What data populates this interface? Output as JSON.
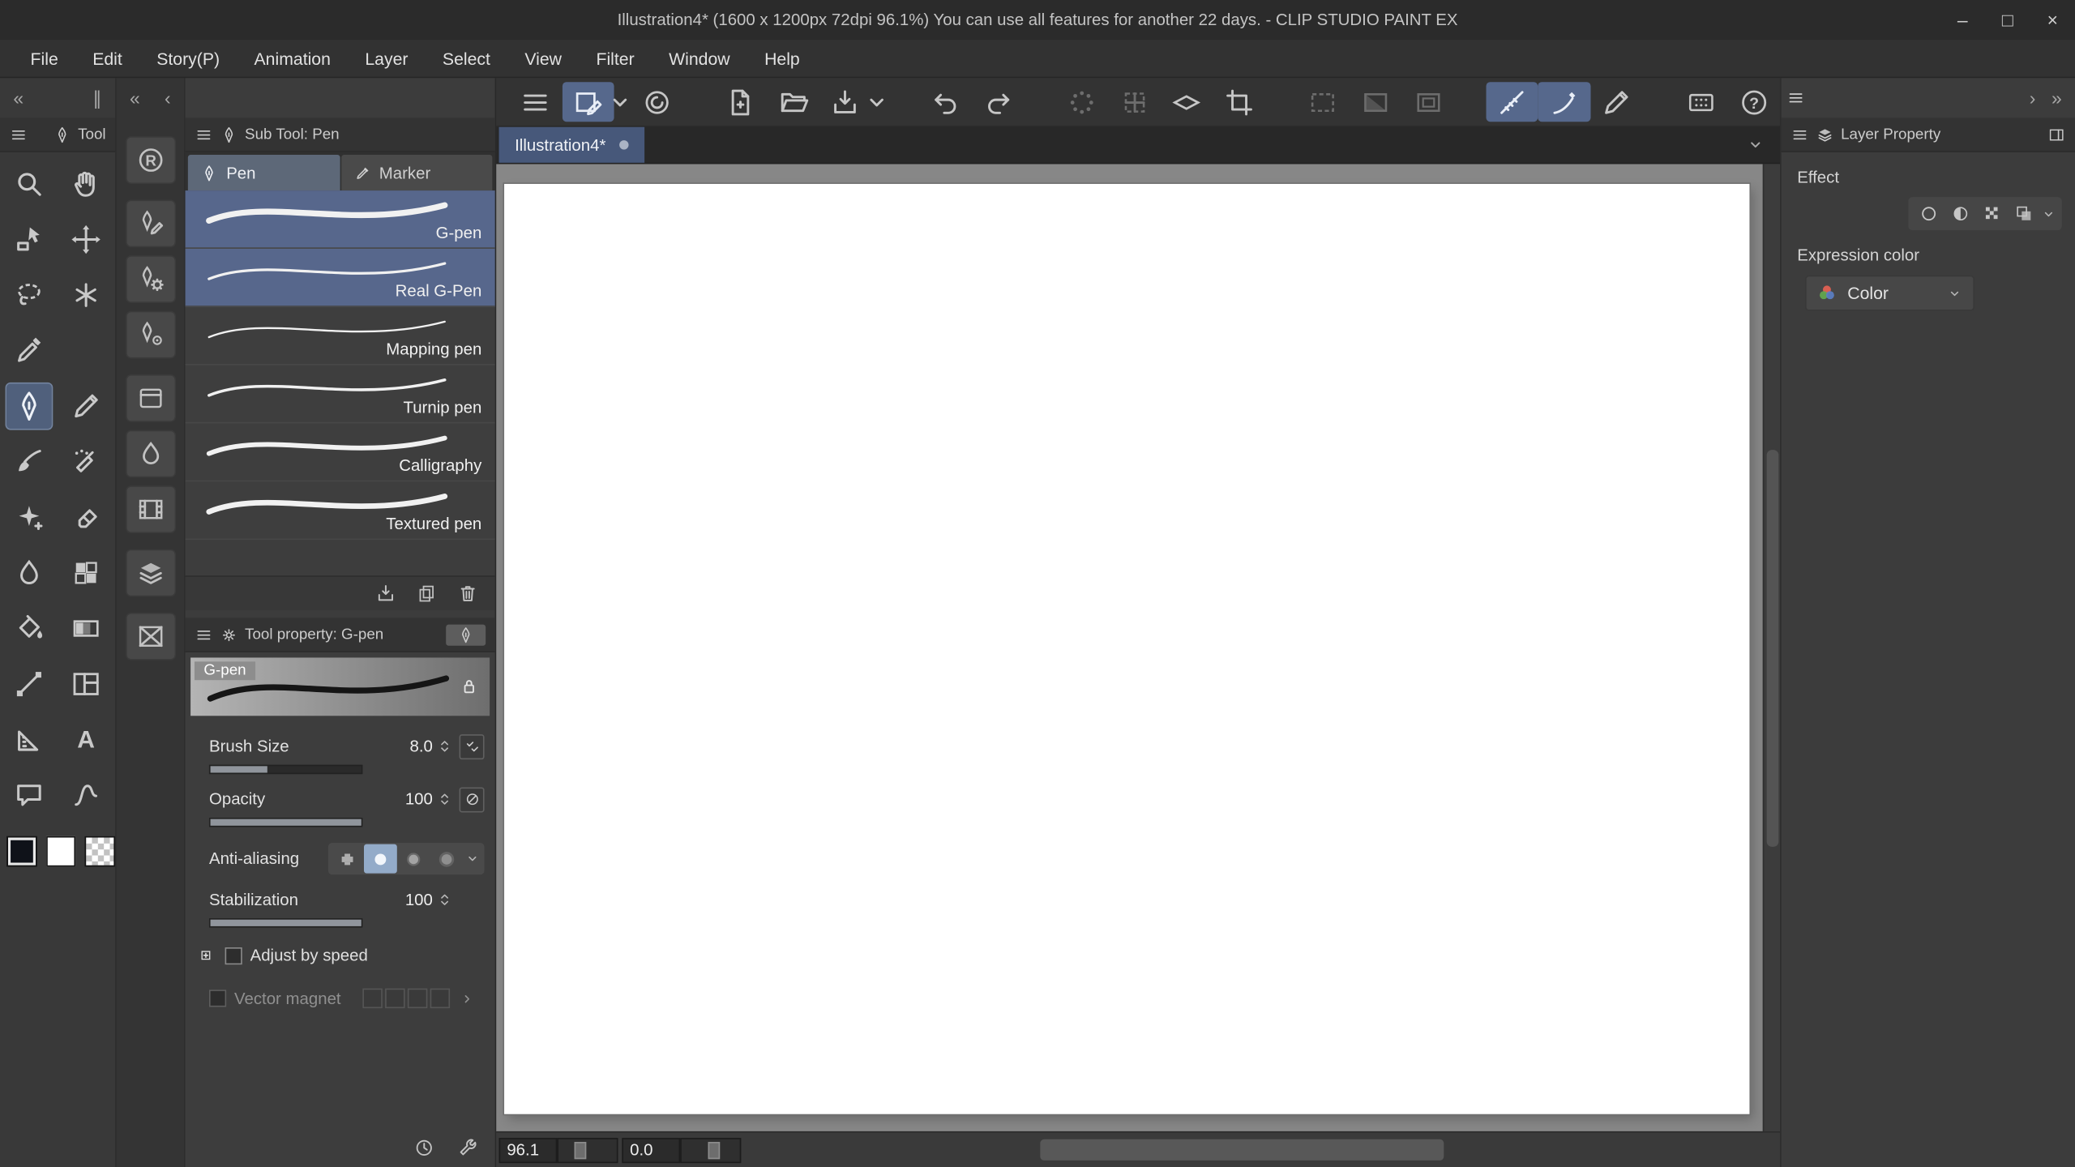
{
  "titlebar": {
    "title": "Illustration4* (1600 x 1200px 72dpi 96.1%)  You can use all features for another 22 days. - CLIP STUDIO PAINT EX",
    "minimize": "–",
    "maximize": "□",
    "close": "×"
  },
  "menubar": {
    "items": [
      "File",
      "Edit",
      "Story(P)",
      "Animation",
      "Layer",
      "Select",
      "View",
      "Filter",
      "Window",
      "Help"
    ]
  },
  "chrome": {
    "collapse_left": "«",
    "handle": "∥",
    "strip_collapse": "«",
    "strip_prev": "‹",
    "right_next": "›",
    "right_last": "»"
  },
  "toolbar": {
    "items": [
      {
        "name": "menu"
      },
      {
        "name": "canvas-edit",
        "state": "active"
      },
      {
        "name": "chevron-down",
        "small": true
      },
      {
        "name": "clip-studio"
      },
      {
        "gap": true
      },
      {
        "name": "new-file"
      },
      {
        "name": "open-file"
      },
      {
        "name": "save-file"
      },
      {
        "name": "chevron-down",
        "small": true
      },
      {
        "gap": true
      },
      {
        "name": "undo"
      },
      {
        "name": "redo"
      },
      {
        "gap": true
      },
      {
        "name": "spinner",
        "state": "dim"
      },
      {
        "name": "move-grid",
        "state": "dim"
      },
      {
        "name": "flat-diamond"
      },
      {
        "name": "crop"
      },
      {
        "gap": true
      },
      {
        "name": "select-dashed",
        "state": "dim"
      },
      {
        "name": "select-fill",
        "state": "dim"
      },
      {
        "name": "select-frame",
        "state": "dim"
      },
      {
        "gap": true
      },
      {
        "name": "snap-ruler",
        "state": "active"
      },
      {
        "name": "snap-brush",
        "state": "active"
      },
      {
        "name": "correct-line"
      },
      {
        "gap": true
      },
      {
        "name": "tablet"
      },
      {
        "name": "help"
      }
    ]
  },
  "tool_panel": {
    "title": "Tool",
    "menu_icon": "menu",
    "header_icon": "pen",
    "tools": [
      {
        "name": "zoom"
      },
      {
        "name": "hand"
      },
      {
        "name": "operation"
      },
      {
        "name": "move-layer"
      },
      {
        "name": "lasso"
      },
      {
        "name": "auto-select"
      },
      {
        "name": "eyedropper"
      },
      {
        "name": "blank"
      },
      {
        "name": "pen",
        "selected": true
      },
      {
        "name": "pencil"
      },
      {
        "name": "brush"
      },
      {
        "name": "airbrush"
      },
      {
        "name": "decoration"
      },
      {
        "name": "eraser"
      },
      {
        "name": "blend"
      },
      {
        "name": "tone"
      },
      {
        "name": "fill"
      },
      {
        "name": "gradient"
      },
      {
        "name": "figure"
      },
      {
        "name": "frame"
      },
      {
        "name": "ruler"
      },
      {
        "name": "text"
      },
      {
        "name": "balloon"
      },
      {
        "name": "liquify"
      }
    ],
    "swatches": {
      "main_color": "#0f1219",
      "sub_color": "#ffffff",
      "transparent": "checker"
    }
  },
  "subtool_strip": {
    "items": [
      {
        "name": "circled-r"
      },
      {
        "name": "pen-edit",
        "gap": true
      },
      {
        "name": "pen-gear"
      },
      {
        "name": "pen-dial"
      },
      {
        "name": "card",
        "gap": true
      },
      {
        "name": "drop"
      },
      {
        "name": "film"
      },
      {
        "name": "layers",
        "gap": true
      },
      {
        "name": "no-image",
        "gap": true
      }
    ]
  },
  "subtool_panel": {
    "title": "Sub Tool: Pen",
    "header_icon": "pen",
    "tabs": [
      {
        "label": "Pen",
        "icon": "pen",
        "selected": true
      },
      {
        "label": "Marker",
        "icon": "marker",
        "selected": false
      }
    ],
    "brushes": [
      {
        "name": "G-pen",
        "selected": true,
        "weight": 5
      },
      {
        "name": "Real G-Pen",
        "selected": true,
        "weight": 2.2
      },
      {
        "name": "Mapping pen",
        "weight": 1.6
      },
      {
        "name": "Turnip pen",
        "weight": 2.4
      },
      {
        "name": "Calligraphy",
        "weight": 4
      },
      {
        "name": "Textured pen",
        "weight": 4.6
      }
    ],
    "footer_icons": [
      "import",
      "duplicate",
      "trash"
    ]
  },
  "tool_property": {
    "title": "Tool property: G-pen",
    "header_icon": "gear",
    "edit_icon": "pen",
    "preview_label": "G-pen",
    "lock_icon": "lock",
    "brush_size": {
      "label": "Brush Size",
      "value": "8.0",
      "fill": 0.38,
      "button_icon": "dual-check"
    },
    "opacity": {
      "label": "Opacity",
      "value": "100",
      "fill": 1,
      "button_icon": "no-entry"
    },
    "anti_aliasing": {
      "label": "Anti-aliasing",
      "options": [
        "aa-hard",
        "aa-circle",
        "aa-soft",
        "aa-softer"
      ],
      "selected_index": 1
    },
    "stabilization": {
      "label": "Stabilization",
      "value": "100",
      "fill": 1
    },
    "adjust_by_speed_label": "Adjust by speed",
    "vector_magnet_label": "Vector magnet",
    "footer_icons": [
      "clock",
      "wrench"
    ]
  },
  "document": {
    "tab_label": "Illustration4*",
    "zoom_value": "96.1",
    "rotation_value": "0.0"
  },
  "layer_property": {
    "title": "Layer Property",
    "header_icon": "layers",
    "panel_icon": "panel-layout",
    "effect_label": "Effect",
    "effect_icons": [
      "effect-border",
      "effect-emboss",
      "effect-tone",
      "effect-layercolor"
    ],
    "expression_label": "Expression color",
    "color_label": "Color",
    "color_icon": "color-wheel"
  },
  "colors": {
    "accent": "#56688c",
    "selected_row": "#57678c",
    "canvas_surround": "#878787",
    "document_tab": "#47587a"
  }
}
